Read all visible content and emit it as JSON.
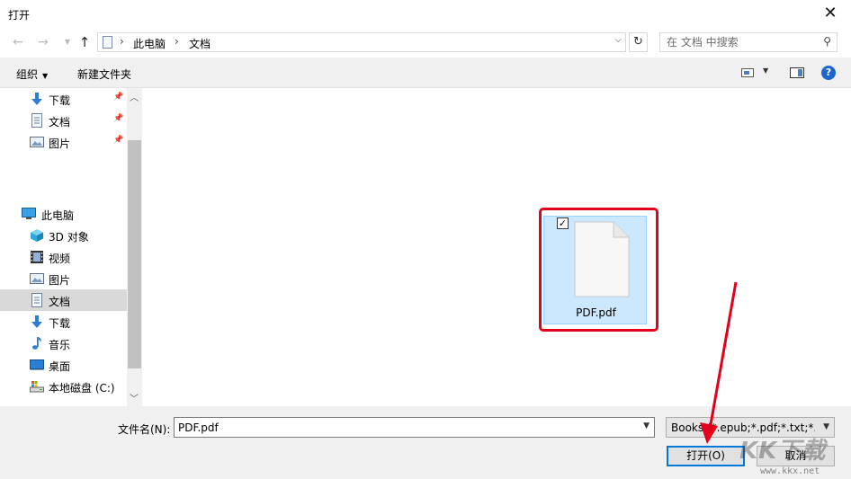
{
  "window": {
    "title": "打开",
    "close_glyph": "✕"
  },
  "address": {
    "breadcrumbs": [
      "此电脑",
      "文档"
    ],
    "search_placeholder": "在 文档 中搜索"
  },
  "toolbar": {
    "organize_label": "组织",
    "new_folder_label": "新建文件夹",
    "help_glyph": "?"
  },
  "nav": {
    "quick_access": [
      {
        "label": "下载",
        "icon": "download-arrow-icon",
        "pinned": true
      },
      {
        "label": "文档",
        "icon": "document-icon",
        "pinned": true
      },
      {
        "label": "图片",
        "icon": "picture-icon",
        "pinned": true
      }
    ],
    "this_pc_label": "此电脑",
    "this_pc_items": [
      {
        "label": "3D 对象",
        "icon": "cube-3d-icon"
      },
      {
        "label": "视频",
        "icon": "video-film-icon"
      },
      {
        "label": "图片",
        "icon": "picture-icon"
      },
      {
        "label": "文档",
        "icon": "document-icon",
        "selected": true
      },
      {
        "label": "下载",
        "icon": "download-arrow-icon"
      },
      {
        "label": "音乐",
        "icon": "music-note-icon"
      },
      {
        "label": "桌面",
        "icon": "desktop-icon"
      },
      {
        "label": "本地磁盘 (C:)",
        "icon": "drive-icon"
      }
    ]
  },
  "files": [
    {
      "name": "PDF.pdf",
      "selected": true,
      "checked": true
    }
  ],
  "bottom": {
    "filename_label": "文件名(N):",
    "filename_value": "PDF.pdf",
    "filetype_value": "Books (*.epub;*.pdf;*.txt;*.mobi)",
    "open_label": "打开(O)",
    "cancel_label": "取消"
  },
  "watermark": {
    "logo_text": "KK下载",
    "url": "www.kkx.net"
  },
  "colors": {
    "selection_bg": "#cce8ff",
    "highlight_red": "#e3001b",
    "accent_blue": "#0078d7",
    "toolbar_bg": "#f0f0f0"
  }
}
